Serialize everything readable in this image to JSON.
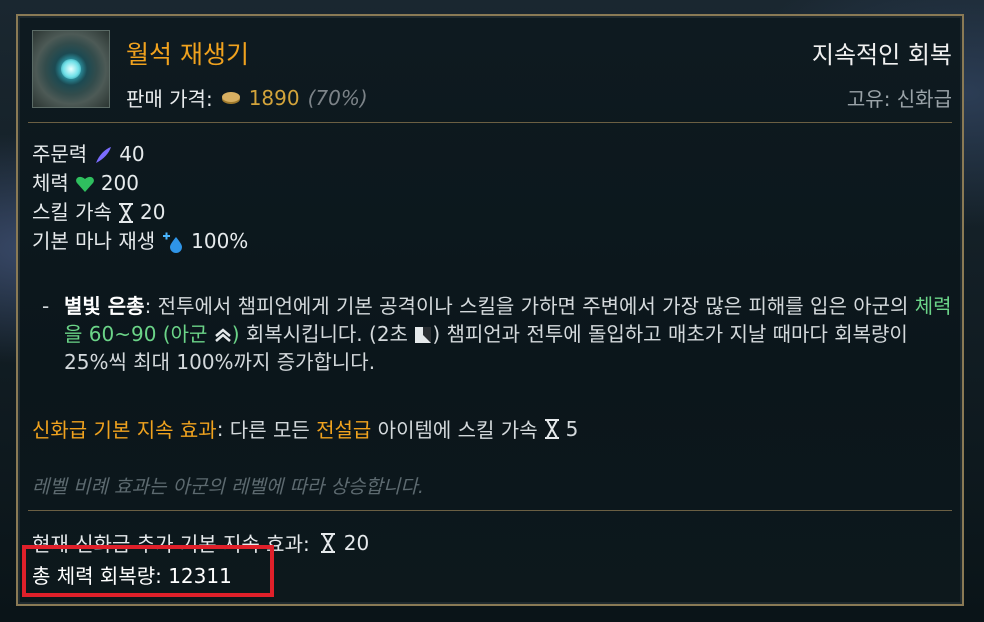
{
  "item": {
    "name": "월석 재생기",
    "category": "지속적인 회복",
    "price_label": "판매 가격:",
    "price_value": "1890",
    "price_pct": "(70%)",
    "rarity": "고유: 신화급"
  },
  "stats": [
    {
      "label": "주문력",
      "icon": "ability-power-icon",
      "value": "40"
    },
    {
      "label": "체력",
      "icon": "health-heart-icon",
      "value": "200"
    },
    {
      "label": "스킬 가속",
      "icon": "hourglass-icon",
      "value": "20"
    },
    {
      "label": "기본 마나 재생",
      "icon": "mana-regen-icon",
      "value": "100%"
    }
  ],
  "passive": {
    "bullet": "-",
    "name": "별빛 은총",
    "colon": ":",
    "text1": " 전투에서 챔피언에게 기본 공격이나 스킬을 가하면 주변에서 가장 많은 피해를 입은 아군의 ",
    "heal_green": "체력을 60~90 (아군",
    "text2": " 회복시킵니다. (2초",
    "text3": ") 챔피언과 전투에 돌입하고 매초가 지날 때마다 회복량이 25%씩 최대 100%까지 증가합니다."
  },
  "mythic": {
    "label": "신화급 기본 지속 효과",
    "colon": ":",
    "text1": " 다른 모든 ",
    "legendary": "전설급",
    "text2": " 아이템에 스킬 가속",
    "value": "5"
  },
  "flavor": "레벨 비례 효과는 아군의 레벨에 따라 상승합니다.",
  "current_bonus": {
    "label": "현재 신화급 추가 기본 지속 효과:",
    "value": "20"
  },
  "total_heal": "총 체력 회복량: 12311",
  "colors": {
    "border": "#8a7a55",
    "name": "#f0a21e",
    "gold": "#d3a43b",
    "heal": "#6bd488",
    "highlight": "#e0202a"
  }
}
